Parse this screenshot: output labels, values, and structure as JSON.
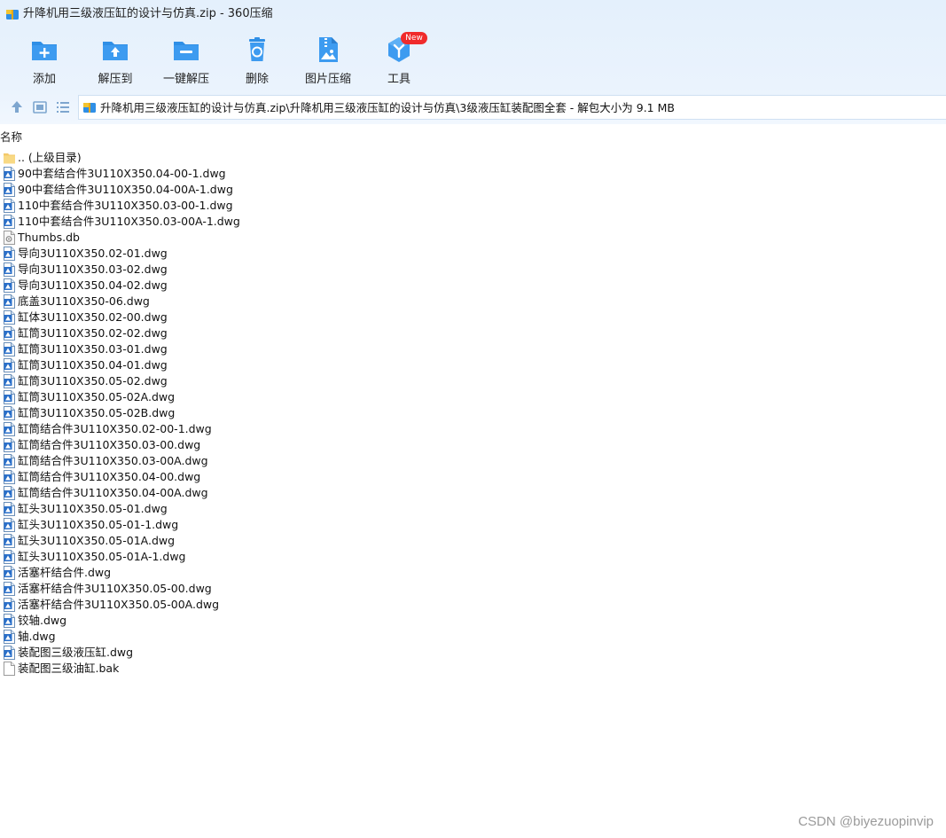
{
  "window": {
    "title": "升降机用三级液压缸的设计与仿真.zip - 360压缩"
  },
  "toolbar": [
    {
      "name": "add",
      "label": "添加",
      "icon": "add-icon"
    },
    {
      "name": "extract-to",
      "label": "解压到",
      "icon": "extract-icon"
    },
    {
      "name": "one-click-extract",
      "label": "一键解压",
      "icon": "one-click-extract-icon"
    },
    {
      "name": "delete",
      "label": "删除",
      "icon": "recycle-icon"
    },
    {
      "name": "image-compress",
      "label": "图片压缩",
      "icon": "image-compress-icon"
    },
    {
      "name": "tools",
      "label": "工具",
      "icon": "tools-icon",
      "badge": "New"
    }
  ],
  "address": {
    "path": "升降机用三级液压缸的设计与仿真.zip\\升降机用三级液压缸的设计与仿真\\3级液压缸装配图全套 - 解包大小为 9.1 MB"
  },
  "list": {
    "column_header": "名称",
    "items": [
      {
        "name": ".. (上级目录)",
        "type": "folder"
      },
      {
        "name": "90中套结合件3U110X350.04-00-1.dwg",
        "type": "dwg"
      },
      {
        "name": "90中套结合件3U110X350.04-00A-1.dwg",
        "type": "dwg"
      },
      {
        "name": "110中套结合件3U110X350.03-00-1.dwg",
        "type": "dwg"
      },
      {
        "name": "110中套结合件3U110X350.03-00A-1.dwg",
        "type": "dwg"
      },
      {
        "name": "Thumbs.db",
        "type": "db"
      },
      {
        "name": "导向3U110X350.02-01.dwg",
        "type": "dwg"
      },
      {
        "name": "导向3U110X350.03-02.dwg",
        "type": "dwg"
      },
      {
        "name": "导向3U110X350.04-02.dwg",
        "type": "dwg"
      },
      {
        "name": "底盖3U110X350-06.dwg",
        "type": "dwg"
      },
      {
        "name": "缸体3U110X350.02-00.dwg",
        "type": "dwg"
      },
      {
        "name": "缸筒3U110X350.02-02.dwg",
        "type": "dwg"
      },
      {
        "name": "缸筒3U110X350.03-01.dwg",
        "type": "dwg"
      },
      {
        "name": "缸筒3U110X350.04-01.dwg",
        "type": "dwg"
      },
      {
        "name": "缸筒3U110X350.05-02.dwg",
        "type": "dwg"
      },
      {
        "name": "缸筒3U110X350.05-02A.dwg",
        "type": "dwg"
      },
      {
        "name": "缸筒3U110X350.05-02B.dwg",
        "type": "dwg"
      },
      {
        "name": "缸筒结合件3U110X350.02-00-1.dwg",
        "type": "dwg"
      },
      {
        "name": "缸筒结合件3U110X350.03-00.dwg",
        "type": "dwg"
      },
      {
        "name": "缸筒结合件3U110X350.03-00A.dwg",
        "type": "dwg"
      },
      {
        "name": "缸筒结合件3U110X350.04-00.dwg",
        "type": "dwg"
      },
      {
        "name": "缸筒结合件3U110X350.04-00A.dwg",
        "type": "dwg"
      },
      {
        "name": "缸头3U110X350.05-01.dwg",
        "type": "dwg"
      },
      {
        "name": "缸头3U110X350.05-01-1.dwg",
        "type": "dwg"
      },
      {
        "name": "缸头3U110X350.05-01A.dwg",
        "type": "dwg"
      },
      {
        "name": "缸头3U110X350.05-01A-1.dwg",
        "type": "dwg"
      },
      {
        "name": "活塞杆结合件.dwg",
        "type": "dwg"
      },
      {
        "name": "活塞杆结合件3U110X350.05-00.dwg",
        "type": "dwg"
      },
      {
        "name": "活塞杆结合件3U110X350.05-00A.dwg",
        "type": "dwg"
      },
      {
        "name": "铰轴.dwg",
        "type": "dwg"
      },
      {
        "name": "轴.dwg",
        "type": "dwg"
      },
      {
        "name": "装配图三级液压缸.dwg",
        "type": "dwg"
      },
      {
        "name": "装配图三级油缸.bak",
        "type": "bak"
      }
    ]
  },
  "watermark": "CSDN @biyezuopinvip",
  "colors": {
    "accent": "#2f8fe6",
    "badge": "#f02b2b",
    "top_band": "#e6f1fc"
  }
}
